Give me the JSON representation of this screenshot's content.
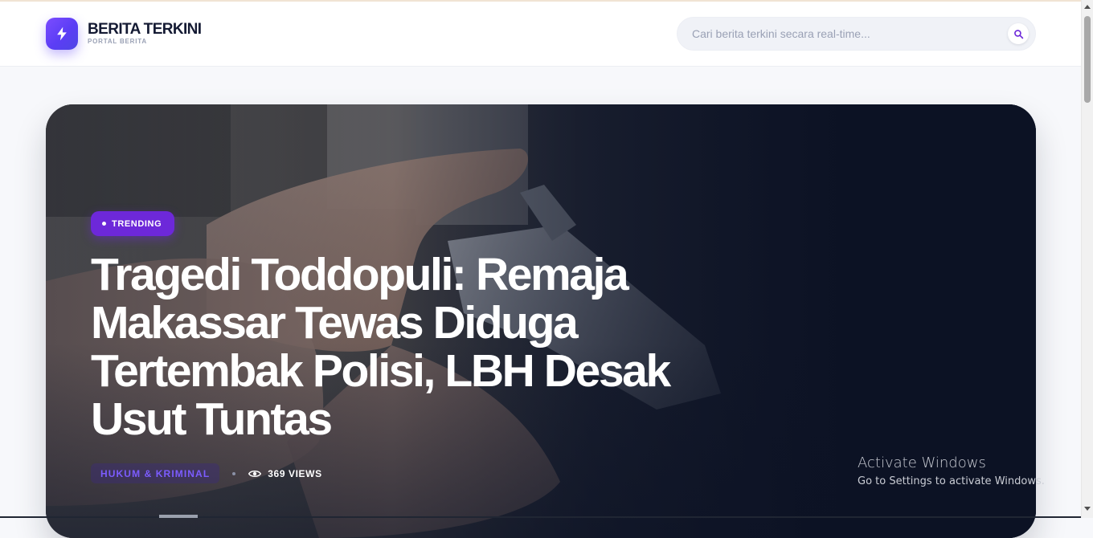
{
  "header": {
    "brand_title": "BERITA TERKINI",
    "brand_subtitle": "PORTAL BERITA",
    "logo_icon": "lightning-bolt-icon",
    "search_placeholder": "Cari berita terkini secara real-time...",
    "search_icon": "search-icon"
  },
  "hero": {
    "badge": "TRENDING",
    "headline": "Tragedi Toddopuli: Remaja Makassar Tewas Diduga Tertembak Polisi, LBH Desak Usut Tuntas",
    "category": "HUKUM & KRIMINAL",
    "views": "369 VIEWS",
    "views_icon": "eye-icon"
  },
  "watermark": {
    "title": "Activate Windows",
    "subtitle": "Go to Settings to activate Windows."
  },
  "colors": {
    "accent": "#6d28d9",
    "brand_gradient_start": "#7c4dff",
    "brand_gradient_end": "#4f46e5",
    "hero_background": "#0f1629",
    "headline_text": "#ffffff"
  }
}
